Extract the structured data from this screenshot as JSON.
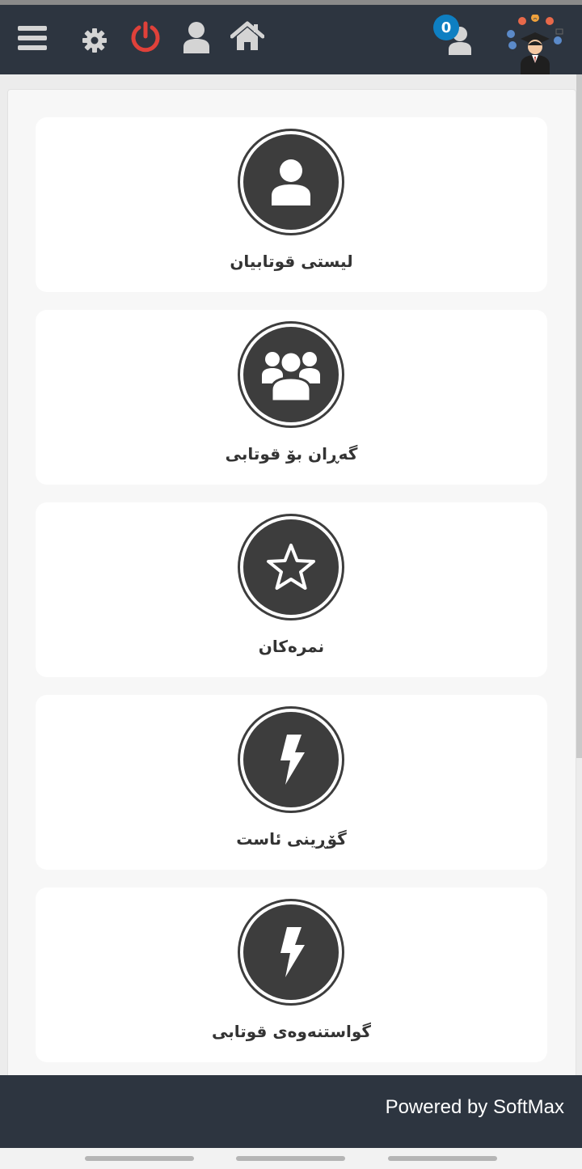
{
  "header": {
    "notification_count": "0",
    "icons": [
      "menu-icon",
      "gear-icon",
      "power-icon",
      "user-icon",
      "home-icon",
      "notification-user-icon"
    ],
    "colors": {
      "bar": "#2d3540",
      "icon": "#d4d4d4",
      "power": "#e0413a",
      "badge": "#0e7fc2"
    }
  },
  "cards": [
    {
      "label": "لیستی قوتابیان",
      "icon": "user-icon"
    },
    {
      "label": "گەڕان بۆ قوتابی",
      "icon": "users-icon"
    },
    {
      "label": "نمرەکان",
      "icon": "star-icon"
    },
    {
      "label": "گۆڕینی ئاست",
      "icon": "bolt-icon"
    },
    {
      "label": "گواستنەوەی قوتابی",
      "icon": "bolt-icon"
    }
  ],
  "footer": {
    "text": "Powered by SoftMax"
  }
}
